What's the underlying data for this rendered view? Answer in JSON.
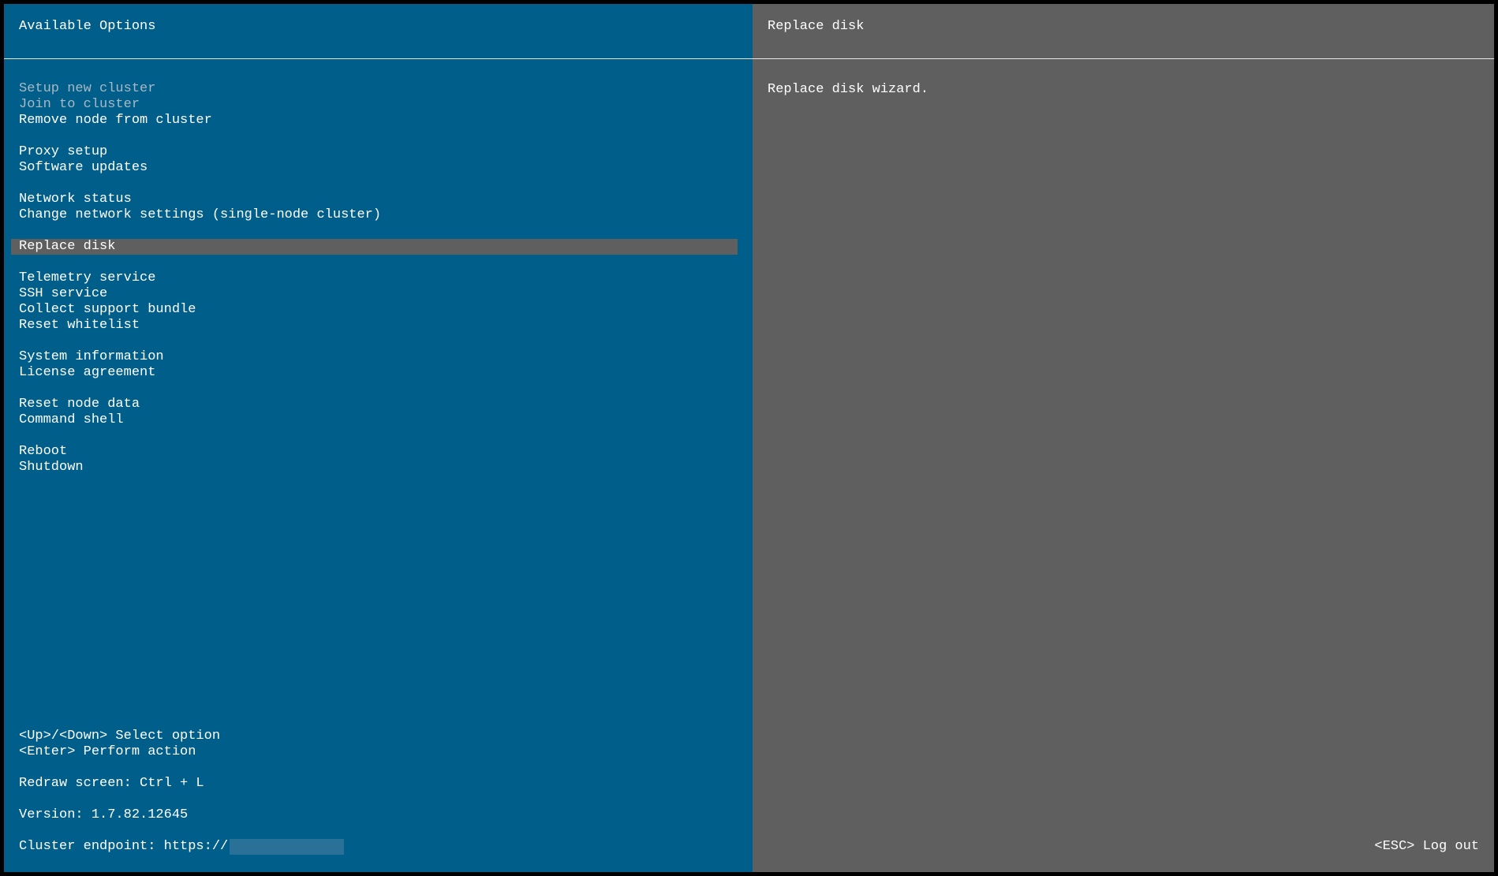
{
  "left_pane": {
    "title": "Available Options"
  },
  "menu": {
    "groups": [
      [
        {
          "label": "Setup new cluster",
          "enabled": false
        },
        {
          "label": "Join to cluster",
          "enabled": false
        },
        {
          "label": "Remove node from cluster",
          "enabled": true
        }
      ],
      [
        {
          "label": "Proxy setup",
          "enabled": true
        },
        {
          "label": "Software updates",
          "enabled": true
        }
      ],
      [
        {
          "label": "Network status",
          "enabled": true
        },
        {
          "label": "Change network settings (single-node cluster)",
          "enabled": true
        }
      ],
      [
        {
          "label": "Replace disk",
          "enabled": true,
          "selected": true
        }
      ],
      [
        {
          "label": "Telemetry service",
          "enabled": true
        },
        {
          "label": "SSH service",
          "enabled": true
        },
        {
          "label": "Collect support bundle",
          "enabled": true
        },
        {
          "label": "Reset whitelist",
          "enabled": true
        }
      ],
      [
        {
          "label": "System information",
          "enabled": true
        },
        {
          "label": "License agreement",
          "enabled": true
        }
      ],
      [
        {
          "label": "Reset node data",
          "enabled": true
        },
        {
          "label": "Command shell",
          "enabled": true
        }
      ],
      [
        {
          "label": "Reboot",
          "enabled": true
        },
        {
          "label": "Shutdown",
          "enabled": true
        }
      ]
    ]
  },
  "footer": {
    "nav_hint": "<Up>/<Down> Select option",
    "enter_hint": "<Enter> Perform action",
    "redraw_hint": "Redraw screen: Ctrl + L",
    "version": "Version: 1.7.82.12645",
    "endpoint_label": "Cluster endpoint: https://"
  },
  "right_pane": {
    "title": "Replace disk",
    "description": "Replace disk wizard.",
    "logout_hint": "<ESC> Log out"
  },
  "colors": {
    "left_background": "#005e8a",
    "right_background": "#5f5f5f",
    "selection_background": "#5f5f5f",
    "disabled_text": "#a8b8c4",
    "text": "#ffffff"
  }
}
